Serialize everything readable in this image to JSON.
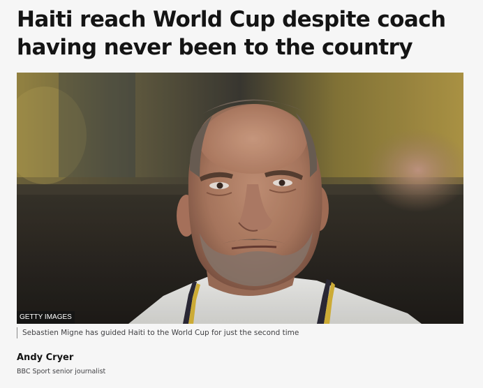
{
  "article": {
    "headline": "Haiti reach World Cup despite coach having never been to the country",
    "image": {
      "credit": "GETTY IMAGES",
      "caption": "Sebastien Migne has guided Haiti to the World Cup for just the second time"
    },
    "byline": {
      "name": "Andy Cryer",
      "role": "BBC Sport senior journalist"
    }
  },
  "colors": {
    "page_background": "#f6f6f6",
    "headline_text": "#141414",
    "secondary_text": "#3f3f42",
    "credit_background": "#141414"
  },
  "icons": [
    "photo-illustration"
  ]
}
